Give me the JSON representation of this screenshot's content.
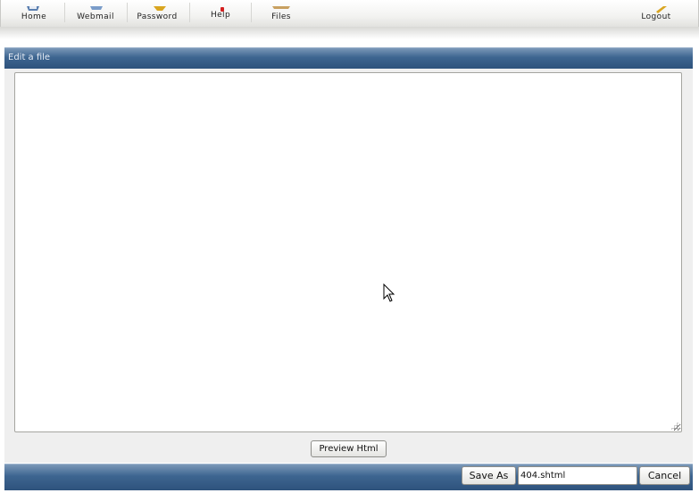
{
  "nav": {
    "items": [
      {
        "key": "home",
        "label": "Home",
        "icon": "home-icon",
        "color": "#5b7fb0"
      },
      {
        "key": "webmail",
        "label": "Webmail",
        "icon": "webmail-icon",
        "color": "#7a9cc9"
      },
      {
        "key": "password",
        "label": "Password",
        "icon": "key-icon",
        "color": "#d9a520"
      },
      {
        "key": "help",
        "label": "Help",
        "icon": "help-icon",
        "color": "#d42020"
      },
      {
        "key": "files",
        "label": "Files",
        "icon": "folder-icon",
        "color": "#c8a060"
      }
    ],
    "logout": {
      "label": "Logout",
      "icon": "logout-icon",
      "color": "#d9a520"
    }
  },
  "panel": {
    "title": "Edit a file"
  },
  "editor": {
    "content": ""
  },
  "actions": {
    "preview_label": "Preview Html",
    "save_as_label": "Save As",
    "filename_value": "404.shtml",
    "cancel_label": "Cancel"
  },
  "colors": {
    "header_dark": "#2e527c",
    "header_light": "#7b98b8",
    "panel_bg": "#efefef"
  }
}
